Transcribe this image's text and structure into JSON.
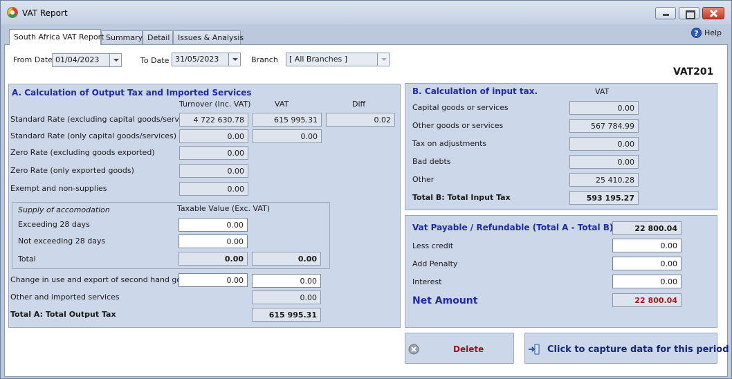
{
  "window": {
    "title": "VAT Report"
  },
  "tabs": [
    "South Africa VAT Report",
    "Summary",
    "Detail",
    "Issues & Analysis"
  ],
  "help": "Help",
  "filters": {
    "from_label": "From Date",
    "from_value": "01/04/2023",
    "to_label": "To Date",
    "to_value": "31/05/2023",
    "branch_label": "Branch",
    "branch_value": "[ All Branches ]"
  },
  "form_code": "VAT201",
  "sectionA": {
    "title": "A. Calculation of Output Tax and Imported Services",
    "col_turnover": "Turnover (Inc. VAT)",
    "col_vat": "VAT",
    "col_diff": "Diff",
    "std_excl_label": "Standard Rate (excluding capital goods/services)",
    "std_excl_turnover": "4 722 630.78",
    "std_excl_vat": "615 995.31",
    "std_excl_diff": "0.02",
    "std_cap_label": "Standard Rate (only capital goods/services)",
    "std_cap_turnover": "0.00",
    "std_cap_vat": "0.00",
    "zero_excl_label": "Zero Rate (excluding goods exported)",
    "zero_excl_value": "0.00",
    "zero_exp_label": "Zero Rate (only exported goods)",
    "zero_exp_value": "0.00",
    "exempt_label": "Exempt and non-supplies",
    "exempt_value": "0.00",
    "accom": {
      "title": "Supply of accomodation",
      "col_taxable": "Taxable Value (Exc. VAT)",
      "exceed_label": "Exceeding 28 days",
      "exceed_value": "0.00",
      "notexceed_label": "Not exceeding 28 days",
      "notexceed_value": "0.00",
      "total_label": "Total",
      "total_taxable": "0.00",
      "total_vat": "0.00"
    },
    "secondhand_label": "Change in use and export of second hand goods",
    "secondhand_value": "0.00",
    "secondhand_vat": "0.00",
    "other_label": "Other and imported services",
    "other_vat": "0.00",
    "total_label": "Total A: Total Output Tax",
    "total_value": "615 995.31"
  },
  "sectionB": {
    "title": "B. Calculation of input tax.",
    "col_vat": "VAT",
    "rows": [
      {
        "label": "Capital goods or services",
        "value": "0.00"
      },
      {
        "label": "Other goods or services",
        "value": "567 784.99"
      },
      {
        "label": "Tax on adjustments",
        "value": "0.00"
      },
      {
        "label": "Bad debts",
        "value": "0.00"
      },
      {
        "label": "Other",
        "value": "25 410.28"
      }
    ],
    "total_label": "Total B: Total Input Tax",
    "total_value": "593 195.27"
  },
  "payable": {
    "title": "Vat Payable / Refundable (Total A - Total B)",
    "title_value": "22 800.04",
    "less_credit_label": "Less credit",
    "less_credit_value": "0.00",
    "penalty_label": "Add Penalty",
    "penalty_value": "0.00",
    "interest_label": "Interest",
    "interest_value": "0.00",
    "net_label": "Net Amount",
    "net_value": "22 800.04"
  },
  "buttons": {
    "delete": "Delete",
    "capture": "Click to capture data for this period"
  }
}
